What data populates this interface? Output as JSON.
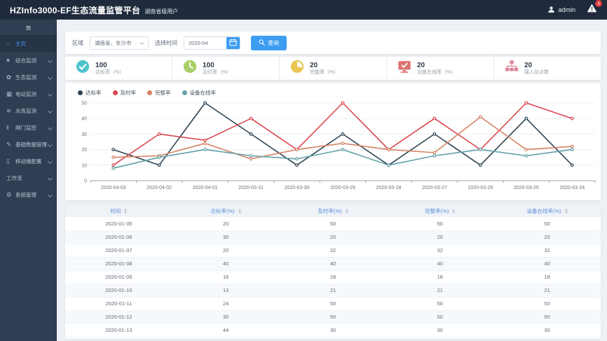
{
  "header": {
    "title": "HZInfo3000-EF生态流量监管平台",
    "subtitle": "湖南省级用户",
    "user": "admin",
    "badge_count": "3"
  },
  "sidebar": {
    "items": [
      {
        "label": "主页",
        "icon": "home-icon",
        "active": true,
        "expandable": false
      },
      {
        "label": "综合监测",
        "icon": "heart-icon",
        "active": false,
        "expandable": true
      },
      {
        "label": "生态监测",
        "icon": "eco-icon",
        "active": false,
        "expandable": true
      },
      {
        "label": "电站监测",
        "icon": "station-icon",
        "active": false,
        "expandable": true
      },
      {
        "label": "水库监测",
        "icon": "reservoir-icon",
        "active": false,
        "expandable": true
      },
      {
        "label": "闸门监控",
        "icon": "gate-icon",
        "active": false,
        "expandable": true
      },
      {
        "label": "基础数据管理",
        "icon": "wrench-icon",
        "active": false,
        "expandable": true
      },
      {
        "label": "移动端配置",
        "icon": "mobile-icon",
        "active": false,
        "expandable": true
      },
      {
        "label": "工作流",
        "icon": "",
        "active": false,
        "expandable": true
      },
      {
        "label": "系统管理",
        "icon": "gear-icon",
        "active": false,
        "expandable": true
      }
    ]
  },
  "filters": {
    "region_label": "区域",
    "region_value": "湖南省，长沙市",
    "time_label": "选择时间",
    "time_value": "2020-04",
    "search_label": "查询"
  },
  "stats": [
    {
      "value": "100",
      "label": "达标率（%）",
      "icon": "check-circle-icon",
      "color": "#4fc4cb"
    },
    {
      "value": "100",
      "label": "及时率（%）",
      "icon": "clock-icon",
      "color": "#a9cf68"
    },
    {
      "value": "20",
      "label": "完整率（%）",
      "icon": "pie-icon",
      "color": "#e8c64f"
    },
    {
      "value": "20",
      "label": "设备在线率（%）",
      "icon": "monitor-icon",
      "color": "#dd7170"
    },
    {
      "value": "20",
      "label": "接入站点数",
      "icon": "sitemap-icon",
      "color": "#dd8596"
    }
  ],
  "chart_data": {
    "type": "line",
    "title": "",
    "xlabel": "",
    "ylabel": "",
    "categories": [
      "2020-04-03",
      "2020-04-02",
      "2020-04-01",
      "2020-03-31",
      "2020-03-30",
      "2020-03-29",
      "2020-03-28",
      "2020-03-27",
      "2020-03-26",
      "2020-03-25",
      "2020-03-24"
    ],
    "series": [
      {
        "name": "达标率",
        "color": "#2f4554",
        "values": [
          20,
          10,
          50,
          30,
          10,
          30,
          10,
          30,
          10,
          40,
          10
        ]
      },
      {
        "name": "及时率",
        "color": "#d9464f",
        "values": [
          10,
          30,
          26,
          40,
          20,
          50,
          20,
          40,
          20,
          50,
          40
        ]
      },
      {
        "name": "完整率",
        "color": "#d48265",
        "values": [
          15,
          16,
          24,
          14,
          20,
          24,
          20,
          18,
          41,
          20,
          22
        ]
      },
      {
        "name": "设备在线率",
        "color": "#61a0a8",
        "values": [
          8,
          15,
          20,
          16,
          14,
          20,
          10,
          16,
          20,
          16,
          20
        ]
      }
    ],
    "ylim": [
      0,
      50
    ],
    "yticks": [
      0,
      10,
      20,
      30,
      40,
      50
    ],
    "grid": true,
    "legend_position": "top-left"
  },
  "table": {
    "columns": [
      "时间",
      "达标率(%)",
      "及时率(%)",
      "完整率(%)",
      "设备在线率(%)"
    ],
    "rows": [
      [
        "2020-01-05",
        "20",
        "50",
        "50",
        "50"
      ],
      [
        "2020-01-06",
        "30",
        "20",
        "20",
        "20"
      ],
      [
        "2020-01-07",
        "20",
        "32",
        "32",
        "32"
      ],
      [
        "2020-01-08",
        "40",
        "40",
        "40",
        "40"
      ],
      [
        "2020-01-09",
        "16",
        "18",
        "18",
        "18"
      ],
      [
        "2020-01-10",
        "13",
        "21",
        "21",
        "21"
      ],
      [
        "2020-01-11",
        "24",
        "50",
        "50",
        "50"
      ],
      [
        "2020-01-12",
        "30",
        "50",
        "50",
        "50"
      ],
      [
        "2020-01-13",
        "44",
        "30",
        "30",
        "30"
      ]
    ]
  }
}
